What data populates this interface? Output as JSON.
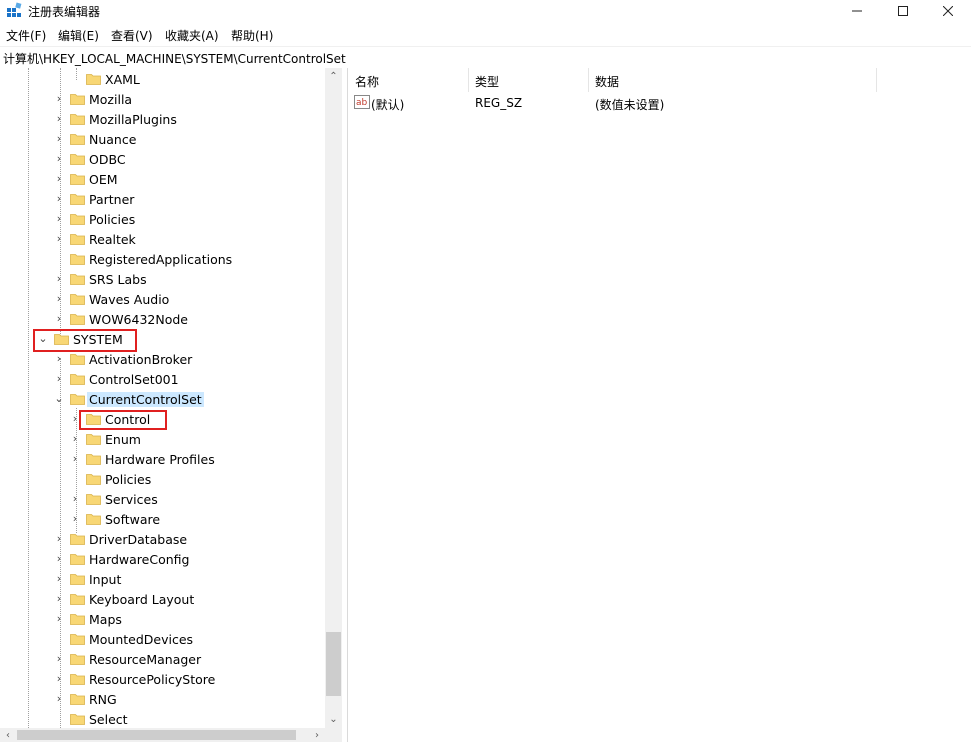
{
  "window": {
    "title": "注册表编辑器",
    "controls": {
      "minimize": "—",
      "maximize": "☐",
      "close": "✕"
    }
  },
  "menu": {
    "items": [
      "文件(F)",
      "编辑(E)",
      "查看(V)",
      "收藏夹(A)",
      "帮助(H)"
    ]
  },
  "address": {
    "path": "计算机\\HKEY_LOCAL_MACHINE\\SYSTEM\\CurrentControlSet"
  },
  "tree": {
    "items": [
      {
        "label": "XAML",
        "level": 2,
        "chevron": "",
        "state": ""
      },
      {
        "label": "Mozilla",
        "level": 1,
        "chevron": "›",
        "state": ""
      },
      {
        "label": "MozillaPlugins",
        "level": 1,
        "chevron": "›",
        "state": ""
      },
      {
        "label": "Nuance",
        "level": 1,
        "chevron": "›",
        "state": ""
      },
      {
        "label": "ODBC",
        "level": 1,
        "chevron": "›",
        "state": ""
      },
      {
        "label": "OEM",
        "level": 1,
        "chevron": "›",
        "state": ""
      },
      {
        "label": "Partner",
        "level": 1,
        "chevron": "›",
        "state": ""
      },
      {
        "label": "Policies",
        "level": 1,
        "chevron": "›",
        "state": ""
      },
      {
        "label": "Realtek",
        "level": 1,
        "chevron": "›",
        "state": ""
      },
      {
        "label": "RegisteredApplications",
        "level": 1,
        "chevron": "",
        "state": ""
      },
      {
        "label": "SRS Labs",
        "level": 1,
        "chevron": "›",
        "state": ""
      },
      {
        "label": "Waves Audio",
        "level": 1,
        "chevron": "›",
        "state": ""
      },
      {
        "label": "WOW6432Node",
        "level": 1,
        "chevron": "›",
        "state": ""
      },
      {
        "label": "SYSTEM",
        "level": 0,
        "chevron": "⌄",
        "state": "expanded"
      },
      {
        "label": "ActivationBroker",
        "level": 1,
        "chevron": "›",
        "state": ""
      },
      {
        "label": "ControlSet001",
        "level": 1,
        "chevron": "›",
        "state": ""
      },
      {
        "label": "CurrentControlSet",
        "level": 1,
        "chevron": "⌄",
        "state": "selected"
      },
      {
        "label": "Control",
        "level": 2,
        "chevron": "›",
        "state": ""
      },
      {
        "label": "Enum",
        "level": 2,
        "chevron": "›",
        "state": ""
      },
      {
        "label": "Hardware Profiles",
        "level": 2,
        "chevron": "›",
        "state": ""
      },
      {
        "label": "Policies",
        "level": 2,
        "chevron": "",
        "state": ""
      },
      {
        "label": "Services",
        "level": 2,
        "chevron": "›",
        "state": ""
      },
      {
        "label": "Software",
        "level": 2,
        "chevron": "›",
        "state": ""
      },
      {
        "label": "DriverDatabase",
        "level": 1,
        "chevron": "›",
        "state": ""
      },
      {
        "label": "HardwareConfig",
        "level": 1,
        "chevron": "›",
        "state": ""
      },
      {
        "label": "Input",
        "level": 1,
        "chevron": "›",
        "state": ""
      },
      {
        "label": "Keyboard Layout",
        "level": 1,
        "chevron": "›",
        "state": ""
      },
      {
        "label": "Maps",
        "level": 1,
        "chevron": "›",
        "state": ""
      },
      {
        "label": "MountedDevices",
        "level": 1,
        "chevron": "",
        "state": ""
      },
      {
        "label": "ResourceManager",
        "level": 1,
        "chevron": "›",
        "state": ""
      },
      {
        "label": "ResourcePolicyStore",
        "level": 1,
        "chevron": "›",
        "state": ""
      },
      {
        "label": "RNG",
        "level": 1,
        "chevron": "›",
        "state": ""
      },
      {
        "label": "Select",
        "level": 1,
        "chevron": "",
        "state": ""
      }
    ]
  },
  "scroll": {
    "up": "⌃",
    "down": "⌄",
    "left": "‹",
    "right": "›"
  },
  "values": {
    "headers": {
      "name": "名称",
      "type": "类型",
      "data": "数据"
    },
    "rows": [
      {
        "icon": "string-value-icon",
        "name": "(默认)",
        "type": "REG_SZ",
        "data": "(数值未设置)"
      }
    ]
  },
  "colors": {
    "selection": "#cce8ff",
    "folder": "#f8d775",
    "highlight_box": "#e02020"
  }
}
